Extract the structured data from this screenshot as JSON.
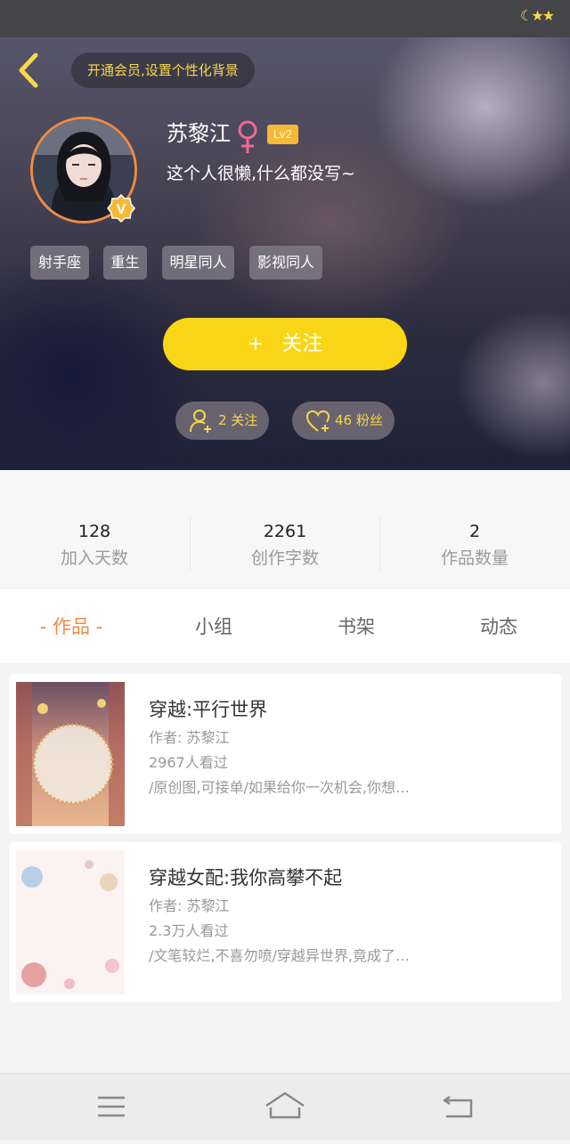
{
  "header": {
    "vip_prompt": "开通会员,设置个性化背景",
    "username": "苏黎江",
    "gender_icon": "female-icon",
    "level": "Lv2",
    "bio": "这个人很懒,什么都没写~",
    "tags": [
      "射手座",
      "重生",
      "明星同人",
      "影视同人"
    ],
    "follow_plus": "+",
    "follow_label": "关注",
    "following_text": "2 关注",
    "fans_text": "46 粉丝"
  },
  "stats": [
    {
      "value": "128",
      "label": "加入天数"
    },
    {
      "value": "2261",
      "label": "创作字数"
    },
    {
      "value": "2",
      "label": "作品数量"
    }
  ],
  "tabs": [
    "- 作品 -",
    "小组",
    "书架",
    "动态"
  ],
  "works": [
    {
      "title": "穿越:平行世界",
      "author": "作者: 苏黎江",
      "views": "2967人看过",
      "desc": "/原创图,可接单/如果给你一次机会,你想…"
    },
    {
      "title": "穿越女配:我你高攀不起",
      "author": "作者: 苏黎江",
      "views": "2.3万人看过",
      "desc": "/文笔较烂,不喜勿喷/穿越异世界,竟成了…"
    }
  ],
  "colors": {
    "accent_yellow": "#f8d617",
    "accent_orange": "#f08a45",
    "level_badge": "#f6b934"
  }
}
